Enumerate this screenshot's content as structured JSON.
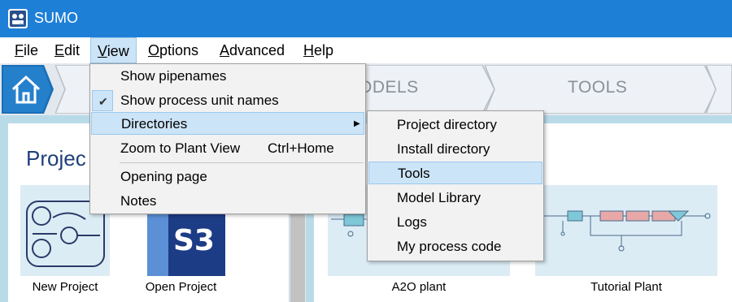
{
  "app": {
    "title": "SUMO",
    "icon": "sumo-logo-icon"
  },
  "menubar": {
    "items": [
      {
        "label": "File",
        "mnemonic": "F"
      },
      {
        "label": "Edit",
        "mnemonic": "E"
      },
      {
        "label": "View",
        "mnemonic": "V",
        "active": true
      },
      {
        "label": "Options",
        "mnemonic": "O"
      },
      {
        "label": "Advanced",
        "mnemonic": "A"
      },
      {
        "label": "Help",
        "mnemonic": "H"
      }
    ]
  },
  "nav": {
    "home_icon": "home-icon",
    "tabs": [
      {
        "label": "ODELS"
      },
      {
        "label": "TOOLS"
      }
    ]
  },
  "view_menu": {
    "items": [
      {
        "label": "Show pipenames",
        "checked": false
      },
      {
        "label": "Show process unit names",
        "checked": true
      },
      {
        "label": "Directories",
        "submenu": true
      },
      {
        "label": "Zoom to Plant View",
        "shortcut": "Ctrl+Home"
      },
      {
        "label": "Opening page"
      },
      {
        "label": "Notes"
      }
    ]
  },
  "directories_submenu": {
    "items": [
      {
        "label": "Project directory"
      },
      {
        "label": "Install directory"
      },
      {
        "label": "Tools"
      },
      {
        "label": "Model Library"
      },
      {
        "label": "Logs"
      },
      {
        "label": "My process code"
      }
    ]
  },
  "main": {
    "section_title": "Projec",
    "projects": [
      {
        "label": "New Project"
      },
      {
        "label": "Open Project"
      },
      {
        "label": "A2O plant"
      },
      {
        "label": "Tutorial Plant"
      }
    ]
  },
  "colors": {
    "titlebar": "#1e7fd6",
    "highlight": "#cce4f7",
    "highlight_border": "#99c9ef",
    "content_bg": "#b9dbe8"
  }
}
